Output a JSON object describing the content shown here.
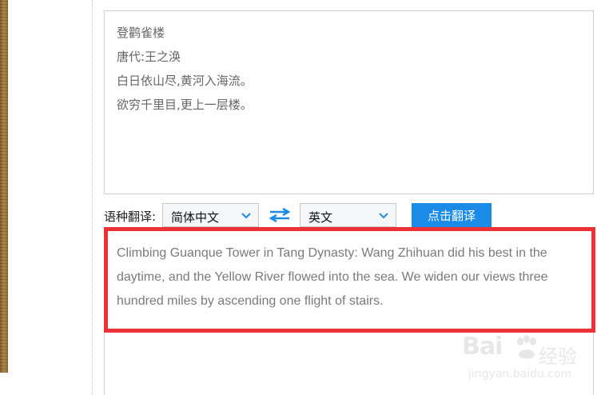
{
  "source_text": {
    "lines": [
      "登鹳雀楼",
      "唐代:王之涣",
      "白日依山尽,黄河入海流。",
      "欲穷千里目,更上一层楼。"
    ]
  },
  "language_bar": {
    "label": "语种翻译:",
    "source_language": "简体中文",
    "target_language": "英文",
    "translate_button": "点击翻译"
  },
  "result": {
    "text": "Climbing Guanque Tower in Tang Dynasty: Wang Zhihuan did his best in the daytime, and the Yellow River flowed into the sea. We widen our views three hundred miles by ascending one flight of stairs."
  },
  "watermark": {
    "brand_prefix": "Bai",
    "brand_cn": "经验",
    "url": "jingyan.baidu.com"
  },
  "colors": {
    "accent_blue": "#1a8ce8",
    "highlight_red": "#ec3236"
  },
  "icons": {
    "swap": "swap-arrows-icon",
    "dropdown": "chevron-down-icon",
    "watermark_paw": "paw-icon"
  }
}
